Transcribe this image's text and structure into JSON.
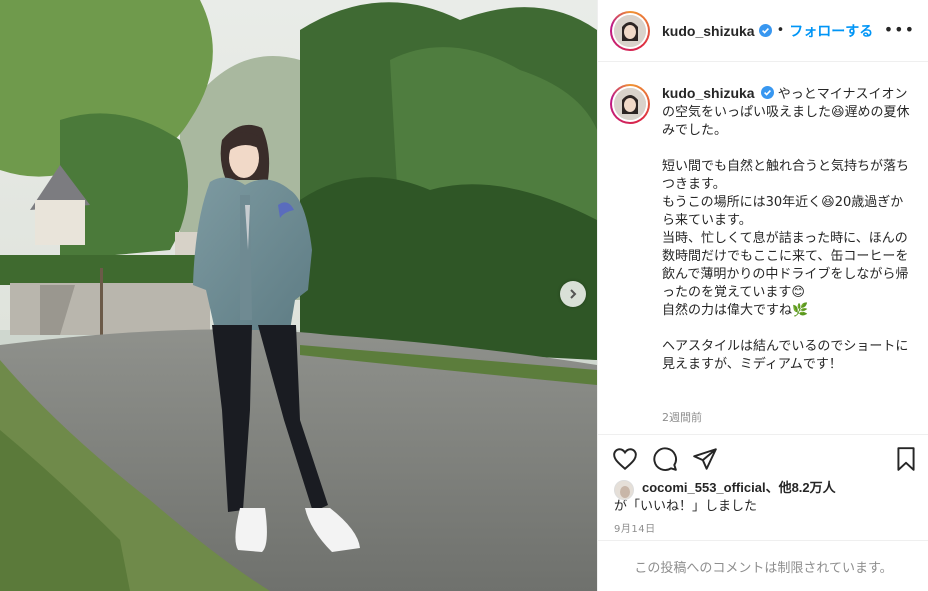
{
  "post": {
    "username": "kudo_shizuka",
    "follow_label": "フォローする",
    "more_label": "•••",
    "separator": "•",
    "caption": "やっとマイナスイオンの空気をいっぱい吸えました😆遅めの夏休みでした。\n\n短い間でも自然と触れ合うと気持ちが落ちつきます。\nもうこの場所には30年近く😆20歳過ぎから来ています。\n当時、忙しくて息が詰まった時に、ほんの数時間だけでもここに来て、缶コーヒーを飲んで薄明かりの中ドライブをしながら帰ったのを覚えています😊\n自然の力は偉大ですね🌿\n\nヘアスタイルは結んでいるのでショートに見えますが、ミディアムです！",
    "time_ago": "2週間前",
    "likes_user": "cocomi_553_official",
    "likes_others": "、他8.2万人",
    "likes_suffix": "が「いいね！」しました",
    "date": "9月14日",
    "comments_disabled": "この投稿へのコメントは制限されています。"
  },
  "icons": {
    "verified": "verified-badge-icon",
    "like": "heart-icon",
    "comment": "comment-icon",
    "share": "paper-plane-icon",
    "save": "bookmark-icon",
    "next": "chevron-right-icon"
  },
  "colors": {
    "accent": "#0095f6",
    "text": "#262626",
    "muted": "#8e8e8e",
    "border": "#efefef"
  }
}
